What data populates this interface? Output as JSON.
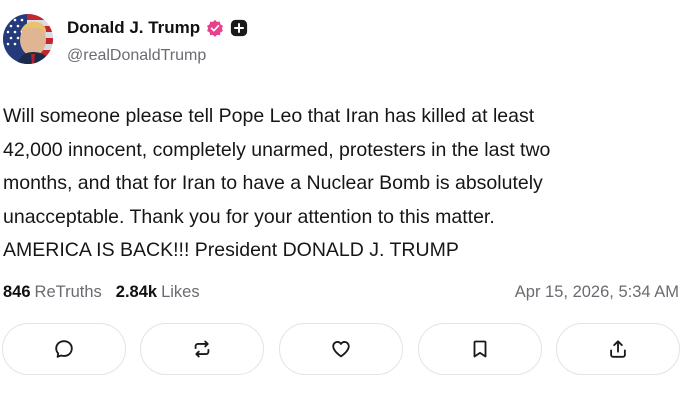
{
  "author": {
    "display_name": "Donald J. Trump",
    "handle": "@realDonaldTrump",
    "verified_badge_color": "#e8408c"
  },
  "post": {
    "text": "Will someone please tell Pope Leo that Iran has killed at least\n42,000 innocent, completely unarmed, protesters in the last two\nmonths, and that for Iran to have a Nuclear Bomb is absolutely\nunacceptable. Thank you for your attention to this matter.\nAMERICA IS BACK!!! President DONALD J. TRUMP"
  },
  "stats": {
    "retruths_count": "846",
    "retruths_label": "ReTruths",
    "likes_count": "2.84k",
    "likes_label": "Likes",
    "timestamp": "Apr 15, 2026, 5:34 AM"
  },
  "actions": [
    {
      "name": "reply",
      "icon": "speech-bubble-icon"
    },
    {
      "name": "retruth",
      "icon": "repost-icon"
    },
    {
      "name": "like",
      "icon": "heart-icon"
    },
    {
      "name": "bookmark",
      "icon": "bookmark-icon"
    },
    {
      "name": "share",
      "icon": "share-icon"
    }
  ]
}
